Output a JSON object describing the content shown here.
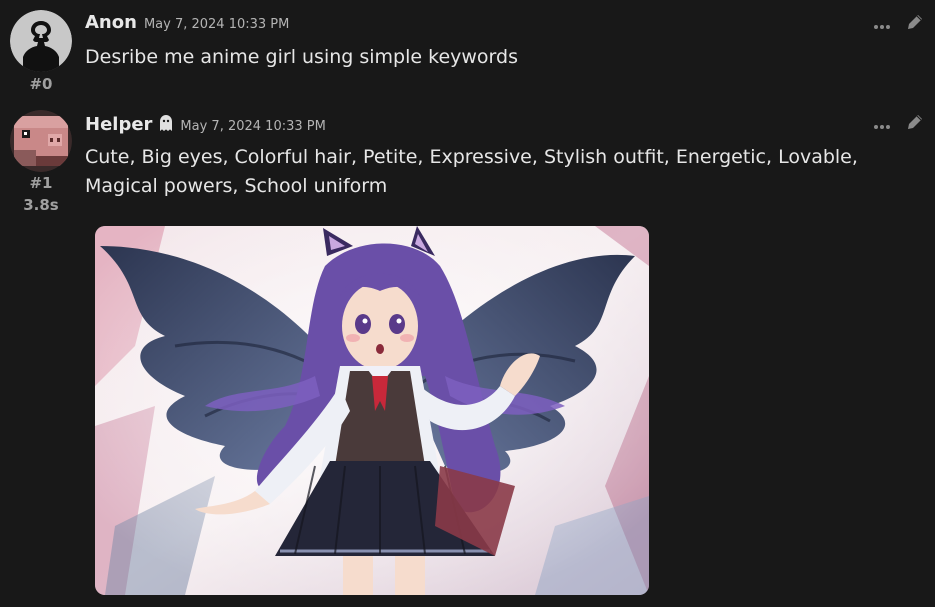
{
  "messages": [
    {
      "author": "Anon",
      "timestamp": "May 7, 2024 10:33 PM",
      "index": "#0",
      "text": "Desribe me anime girl using simple keywords",
      "avatar_icon": "user-silhouette-icon"
    },
    {
      "author": "Helper",
      "author_badge_icon": "ghost-icon",
      "timestamp": "May 7, 2024 10:33 PM",
      "index": "#1",
      "gen_time": "3.8s",
      "text": "Cute, Big eyes, Colorful hair, Petite, Expressive, Stylish outfit, Energetic, Lovable, Magical powers, School uniform",
      "avatar_icon": "pig-avatar-icon",
      "image_subject": "anime-girl-illustration"
    }
  ],
  "colors": {
    "background": "#181818",
    "text": "#e6e6e6",
    "muted": "#a0a0a0"
  },
  "icons": {
    "more": "more-options-icon",
    "edit": "edit-pencil-icon"
  }
}
